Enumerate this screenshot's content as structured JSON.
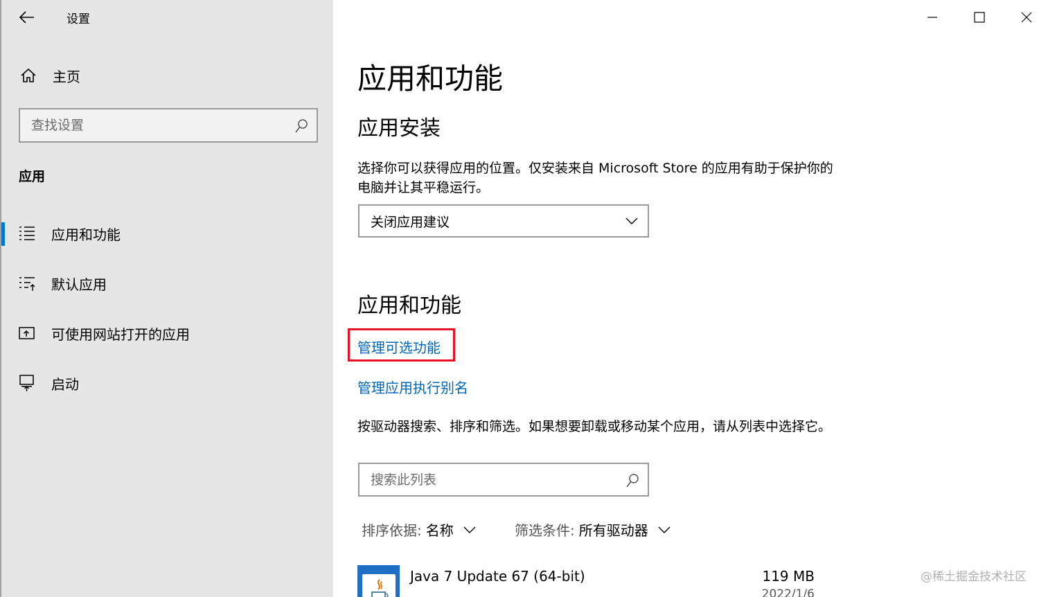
{
  "window": {
    "title": "设置"
  },
  "sidebar": {
    "home_label": "主页",
    "search_placeholder": "查找设置",
    "section_label": "应用",
    "items": [
      {
        "label": "应用和功能",
        "icon": "list-icon",
        "active": true
      },
      {
        "label": "默认应用",
        "icon": "default-apps-icon",
        "active": false
      },
      {
        "label": "可使用网站打开的应用",
        "icon": "websites-icon",
        "active": false
      },
      {
        "label": "启动",
        "icon": "startup-icon",
        "active": false
      }
    ]
  },
  "main": {
    "title": "应用和功能",
    "install_section": {
      "heading": "应用安装",
      "description": "选择你可以获得应用的位置。仅安装来自 Microsoft Store 的应用有助于保护你的电脑并让其平稳运行。",
      "dropdown_value": "关闭应用建议"
    },
    "features_section": {
      "heading": "应用和功能",
      "link_optional": "管理可选功能",
      "link_alias": "管理应用执行别名",
      "description": "按驱动器搜索、排序和筛选。如果想要卸载或移动某个应用，请从列表中选择它。",
      "search_placeholder": "搜索此列表",
      "sort_key": "排序依据:",
      "sort_value": "名称",
      "filter_key": "筛选条件:",
      "filter_value": "所有驱动器"
    },
    "apps": [
      {
        "name": "Java 7 Update 67 (64-bit)",
        "size": "119 MB",
        "date": "2022/1/6"
      }
    ]
  },
  "watermark": "@稀土掘金技术社区",
  "colors": {
    "accent": "#0078d7",
    "link": "#0067b8",
    "highlight": "#e81123"
  }
}
